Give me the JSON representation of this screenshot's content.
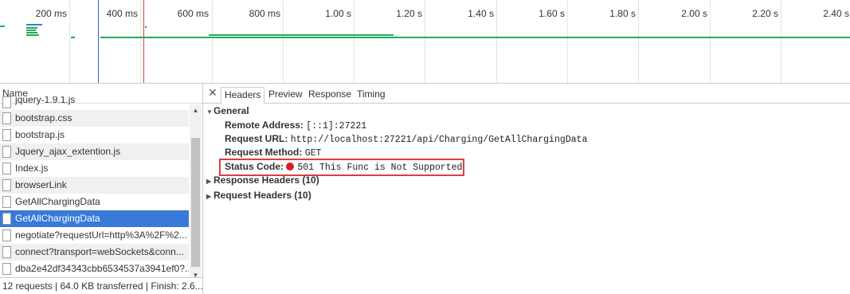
{
  "timeline": {
    "ticks": [
      "200 ms",
      "400 ms",
      "600 ms",
      "800 ms",
      "1.00 s",
      "1.20 s",
      "1.40 s",
      "1.60 s",
      "1.80 s",
      "2.00 s",
      "2.20 s",
      "2.40 s"
    ],
    "colors": {
      "bar": "#1fae5b",
      "dom_line": "#3b5bd6",
      "load_line": "#e04040"
    }
  },
  "left": {
    "name_header": "Name",
    "requests": [
      "jquery-1.9.1.js",
      "bootstrap.css",
      "bootstrap.js",
      "Jquery_ajax_extention.js",
      "Index.js",
      "browserLink",
      "GetAllChargingData",
      "GetAllChargingData",
      "negotiate?requestUrl=http%3A%2F%2...",
      "connect?transport=webSockets&conn...",
      "dba2e42df34343cbb6534537a3941ef0?..."
    ],
    "selected_index": 7,
    "status": "12 requests  |  64.0 KB transferred  |  Finish: 2.6..."
  },
  "right": {
    "tabs": [
      "Headers",
      "Preview",
      "Response",
      "Timing"
    ],
    "active_tab": "Headers",
    "general_title": "General",
    "remote_address_label": "Remote Address:",
    "remote_address": "[::1]:27221",
    "request_url_label": "Request URL:",
    "request_url": "http://localhost:27221/api/Charging/GetAllChargingData",
    "request_method_label": "Request Method:",
    "request_method": "GET",
    "status_code_label": "Status Code:",
    "status_code": "501 This Func is Not Supported",
    "response_headers": "Response Headers (10)",
    "request_headers": "Request Headers (10)"
  },
  "icons": {
    "close": "close-icon",
    "file": "file-icon",
    "expand": "triangle-right-icon",
    "collapse": "triangle-down-icon",
    "status": "red-dot-icon"
  }
}
